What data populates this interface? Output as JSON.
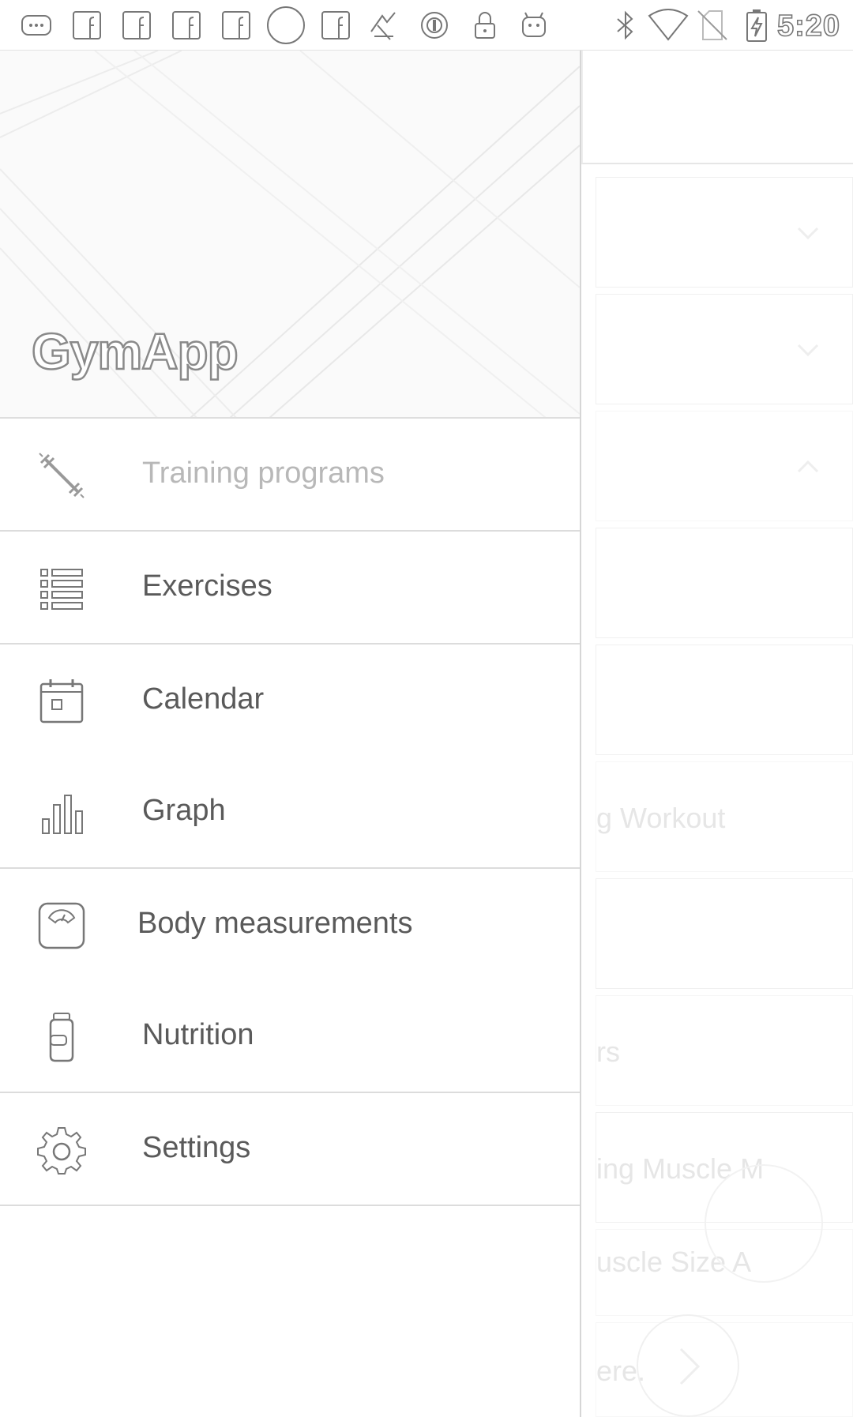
{
  "status_bar": {
    "time": "5:20",
    "icons": [
      "messenger-icon",
      "facebook-icon",
      "facebook-icon",
      "facebook-icon",
      "facebook-icon",
      "circle-icon",
      "facebook-icon",
      "app-icon",
      "sync-icon",
      "lock-icon",
      "android-icon",
      "bluetooth-icon",
      "wifi-icon",
      "no-sim-icon",
      "battery-charging-icon"
    ]
  },
  "drawer": {
    "app_title": "GymApp",
    "items": [
      {
        "label": "Training programs",
        "icon": "dumbbell-icon",
        "active": true
      },
      {
        "label": "Exercises",
        "icon": "list-icon"
      },
      {
        "label": "Calendar",
        "icon": "calendar-icon"
      },
      {
        "label": "Graph",
        "icon": "bar-chart-icon"
      },
      {
        "label": "Body measurements",
        "icon": "scale-icon"
      },
      {
        "label": "Nutrition",
        "icon": "supplement-jar-icon"
      },
      {
        "label": "Settings",
        "icon": "gear-icon"
      }
    ]
  },
  "background": {
    "row_texts": [
      "g Workout",
      "rs",
      "ing Muscle M",
      "uscle Size A",
      "ere."
    ]
  }
}
